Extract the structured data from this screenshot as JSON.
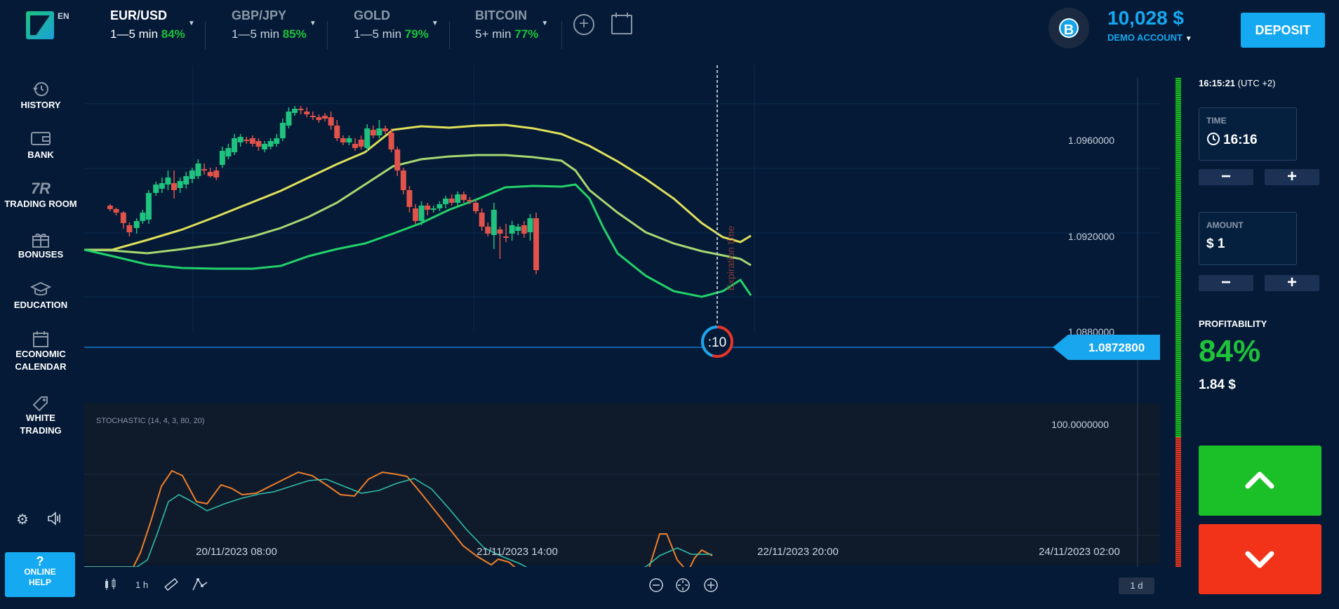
{
  "header": {
    "lang": "EN",
    "assets": [
      {
        "name": "EUR/USD",
        "period": "1—5 min",
        "payout": "84%",
        "active": true
      },
      {
        "name": "GBP/JPY",
        "period": "1—5 min",
        "payout": "85%",
        "active": false
      },
      {
        "name": "GOLD",
        "period": "1—5 min",
        "payout": "79%",
        "active": false
      },
      {
        "name": "BITCOIN",
        "period": "5+ min",
        "payout": "77%",
        "active": false
      }
    ],
    "add_icon": "plus-circle-icon",
    "calendar_icon": "calendar-icon",
    "avatar_letter": "B",
    "balance": "10,028 $",
    "account": "DEMO ACCOUNT",
    "deposit_label": "DEPOSIT"
  },
  "sidebar": {
    "items": [
      {
        "label": "HISTORY",
        "icon": "history-icon"
      },
      {
        "label": "BANK",
        "icon": "wallet-icon"
      },
      {
        "label": "TRADING ROOM",
        "icon": "trading-room-icon"
      },
      {
        "label": "BONUSES",
        "icon": "gift-icon"
      },
      {
        "label": "EDUCATION",
        "icon": "graduation-cap-icon"
      },
      {
        "label": "ECONOMIC CALENDAR",
        "icon": "calendar-icon"
      },
      {
        "label": "WHITE TRADING",
        "icon": "tag-icon"
      }
    ],
    "settings_icon": "gear-icon",
    "sound_icon": "speaker-icon",
    "help_q": "?",
    "help_line1": "ONLINE",
    "help_line2": "HELP"
  },
  "chart": {
    "price_ticks": [
      "1.0960000",
      "1.0920000",
      "1.0880000"
    ],
    "current_price": "1.0872800",
    "expiration_label": "Expiration time",
    "countdown": ":10",
    "stochastic_label": "STOCHASTIC (14, 4, 3, 80, 20)",
    "stoch_tick": "100.0000000",
    "time_ticks": [
      "20/11/2023 08:00",
      "21/11/2023 14:00",
      "22/11/2023 20:00",
      "24/11/2023 02:00"
    ],
    "timeframe": "1 h",
    "range": "1 d"
  },
  "panel": {
    "clock": "16:15:21",
    "tz": "(UTC +2)",
    "time_label": "TIME",
    "time_value": "16:16",
    "amount_label": "AMOUNT",
    "amount_value": "$ 1",
    "minus": "−",
    "plus": "+",
    "profit_label": "PROFITABILITY",
    "profit_pct": "84%",
    "profit_value": "1.84 $"
  },
  "colors": {
    "bg": "#041a36",
    "accent": "#14a9f0",
    "up": "#1bbf28",
    "down": "#f3321a",
    "candle_up": "#1fc27e",
    "candle_down": "#e0524a"
  }
}
